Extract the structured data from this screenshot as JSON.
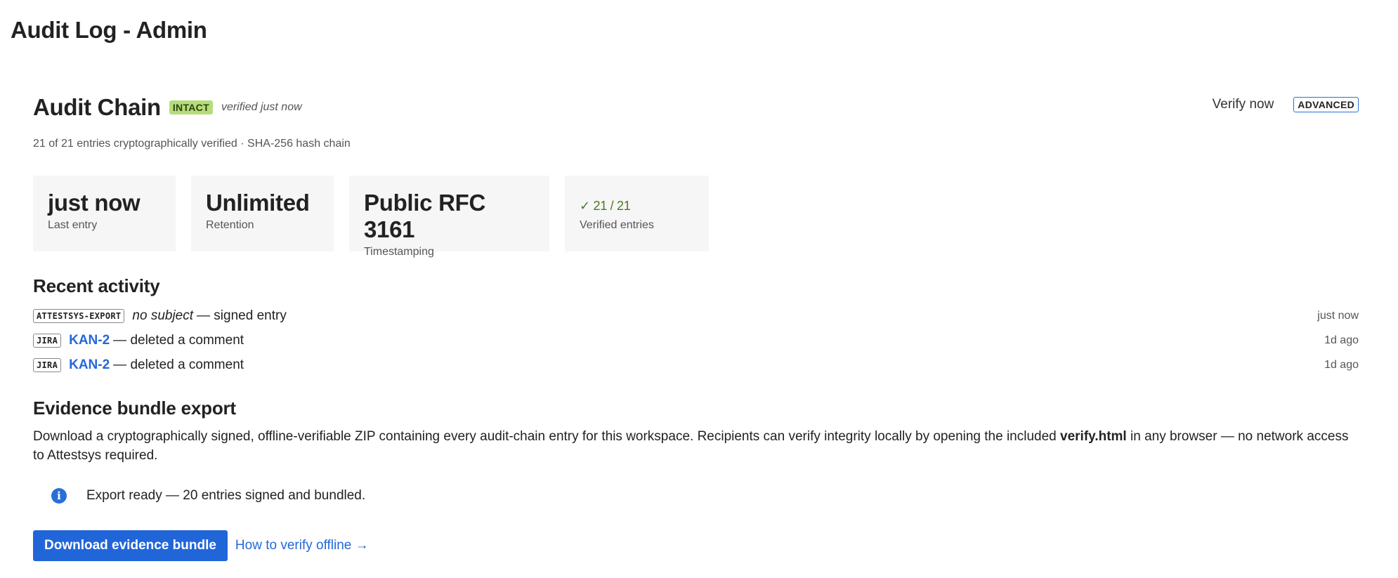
{
  "page": {
    "title": "Audit Log - Admin"
  },
  "chain": {
    "title": "Audit Chain",
    "status_badge": "INTACT",
    "verified_time": "verified just now",
    "subtitle": "21 of 21 entries cryptographically verified · SHA-256 hash chain",
    "verify_label": "Verify now",
    "advanced_label": "ADVANCED"
  },
  "stats": [
    {
      "value": "just now",
      "label": "Last entry"
    },
    {
      "value": "Unlimited",
      "label": "Retention"
    },
    {
      "value": "Public RFC 3161",
      "label": "Timestamping"
    },
    {
      "value": "✓ 21 / 21",
      "label": "Verified entries"
    }
  ],
  "activity": {
    "title": "Recent activity",
    "items": [
      {
        "source": "ATTESTSYS-EXPORT",
        "subject": "no subject",
        "action": "— signed entry",
        "when": "just now"
      },
      {
        "source": "JIRA",
        "subject": "KAN-2",
        "action": "— deleted a comment",
        "when": "1d ago"
      },
      {
        "source": "JIRA",
        "subject": "KAN-2",
        "action": "— deleted a comment",
        "when": "1d ago"
      }
    ]
  },
  "export": {
    "title": "Evidence bundle export",
    "desc_before": "Download a cryptographically signed, offline-verifiable ZIP containing every audit-chain entry for this workspace. Recipients can verify integrity locally by opening the included ",
    "desc_bold": "verify.html",
    "desc_after": " in any browser — no network access to Attestsys required.",
    "notice": "Export ready — 20 entries signed and bundled.",
    "download_label": "Download evidence bundle",
    "how_label": "How to verify offline →"
  },
  "colors": {
    "accent": "#2166d9",
    "intact": "#b5dc7a",
    "ok_text": "#4a7a1f",
    "stat_bg": "#f6f6f6"
  },
  "icons": {
    "notice": "info-icon"
  }
}
